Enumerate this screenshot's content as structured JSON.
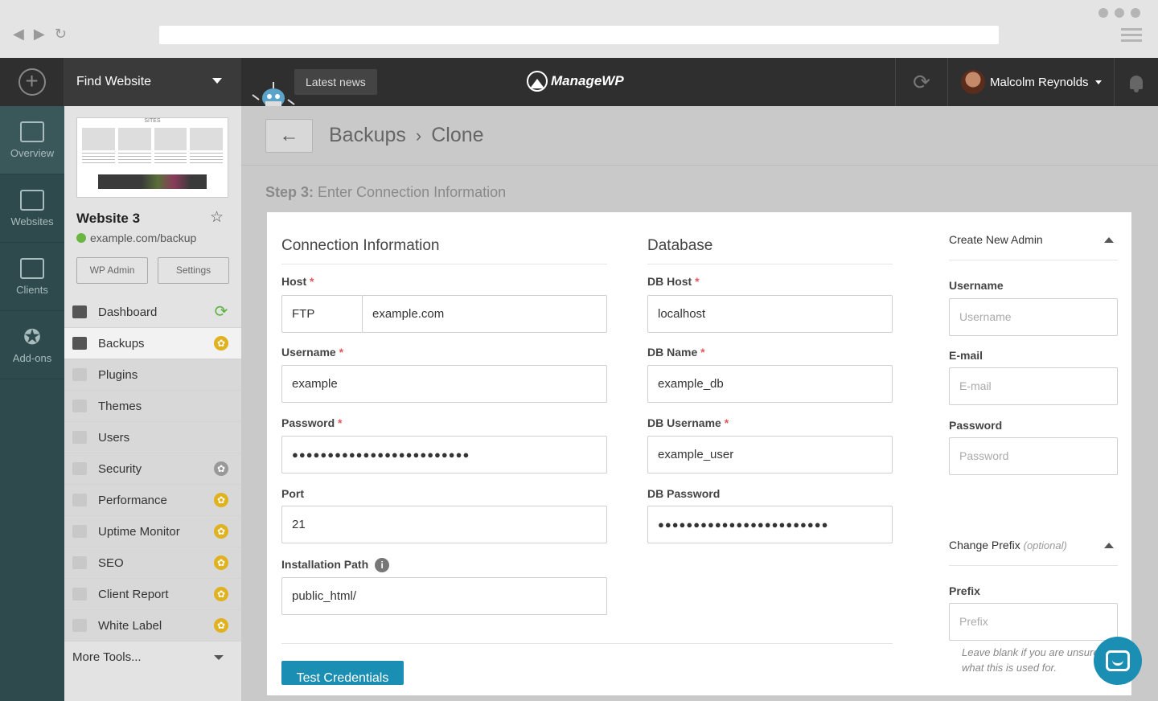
{
  "topbar": {
    "find_website": "Find Website",
    "latest_news": "Latest news",
    "logo": "ManageWP",
    "user_name": "Malcolm Reynolds"
  },
  "leftnav": [
    {
      "label": "Overview"
    },
    {
      "label": "Websites"
    },
    {
      "label": "Clients"
    },
    {
      "label": "Add-ons"
    }
  ],
  "site": {
    "thumb_header": "SITES",
    "title": "Website 3",
    "url": "example.com/backup",
    "wp_admin": "WP Admin",
    "settings": "Settings"
  },
  "menu": {
    "dashboard": "Dashboard",
    "backups": "Backups",
    "plugins": "Plugins",
    "themes": "Themes",
    "users": "Users",
    "security": "Security",
    "performance": "Performance",
    "uptime": "Uptime Monitor",
    "seo": "SEO",
    "client_report": "Client Report",
    "white_label": "White Label",
    "more_tools": "More Tools..."
  },
  "header": {
    "back": "←",
    "crumb1": "Backups",
    "crumb_sep": "›",
    "crumb2": "Clone"
  },
  "step": {
    "prefix": "Step 3:",
    "text": "Enter Connection Information"
  },
  "connection": {
    "title": "Connection Information",
    "host_label": "Host",
    "host_protocol": "FTP",
    "host_value": "example.com",
    "username_label": "Username",
    "username_value": "example",
    "password_label": "Password",
    "password_value": "●●●●●●●●●●●●●●●●●●●●●●●●●",
    "port_label": "Port",
    "port_value": "21",
    "install_label": "Installation Path",
    "install_value": "public_html/",
    "test_button": "Test Credentials"
  },
  "database": {
    "title": "Database",
    "host_label": "DB Host",
    "host_value": "localhost",
    "name_label": "DB Name",
    "name_value": "example_db",
    "user_label": "DB Username",
    "user_value": "example_user",
    "pass_label": "DB Password",
    "pass_value": "●●●●●●●●●●●●●●●●●●●●●●●●"
  },
  "admin": {
    "title": "Create New Admin",
    "username_label": "Username",
    "username_placeholder": "Username",
    "email_label": "E-mail",
    "email_placeholder": "E-mail",
    "password_label": "Password",
    "password_placeholder": "Password"
  },
  "prefix": {
    "title": "Change Prefix",
    "optional": "(optional)",
    "label": "Prefix",
    "placeholder": "Prefix",
    "hint": "Leave blank if you are unsure what this is used for."
  },
  "required_mark": "*"
}
